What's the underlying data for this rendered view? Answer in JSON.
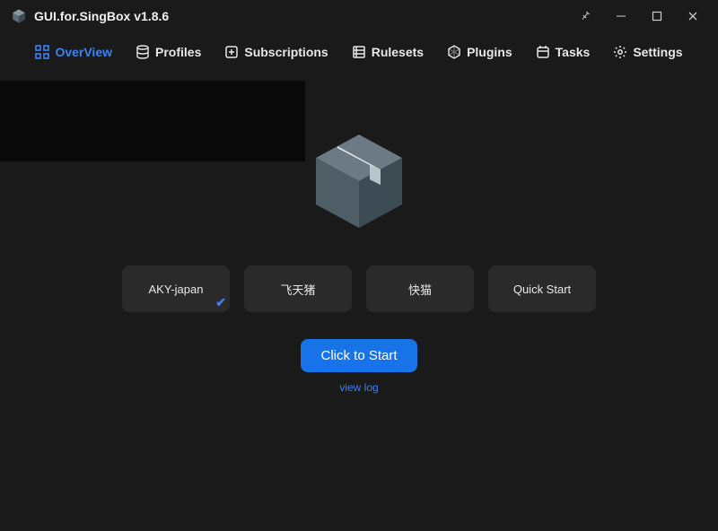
{
  "window": {
    "title": "GUI.for.SingBox v1.8.6"
  },
  "nav": {
    "overview": "OverView",
    "profiles": "Profiles",
    "subscriptions": "Subscriptions",
    "rulesets": "Rulesets",
    "plugins": "Plugins",
    "tasks": "Tasks",
    "settings": "Settings",
    "active": "overview"
  },
  "profiles": [
    {
      "label": "AKY-japan",
      "selected": true
    },
    {
      "label": "飞天猪",
      "selected": false
    },
    {
      "label": "快猫",
      "selected": false
    },
    {
      "label": "Quick Start",
      "selected": false
    }
  ],
  "actions": {
    "start": "Click to Start",
    "viewlog": "view log"
  },
  "colors": {
    "accent": "#3b82f6",
    "button": "#1873e8",
    "bg": "#1a1a1a",
    "card": "#2a2a2a"
  }
}
